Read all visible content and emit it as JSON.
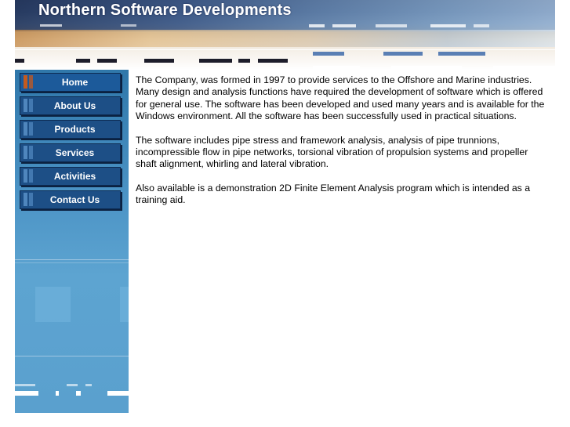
{
  "site": {
    "title": "Northern Software Developments"
  },
  "nav": {
    "items": [
      {
        "label": "Home",
        "active": true
      },
      {
        "label": "About Us",
        "active": false
      },
      {
        "label": "Products",
        "active": false
      },
      {
        "label": "Services",
        "active": false
      },
      {
        "label": "Activities",
        "active": false
      },
      {
        "label": "Contact Us",
        "active": false
      }
    ]
  },
  "content": {
    "paragraphs": [
      "The Company, was formed in 1997 to provide services to the Offshore and Marine industries. Many design and analysis functions have required the development of software which is offered for general use.  The software has been developed and used many years and is available for the Windows environment. All the software has been successfully used in practical situations.",
      "The software includes pipe stress and framework analysis, analysis of pipe trunnions, incompressible flow in pipe networks, torsional vibration of propulsion systems and propeller shaft alignment, whirling and lateral vibration.",
      "Also available is a demonstration 2D Finite Element Analysis program which is intended as a training aid."
    ]
  },
  "colors": {
    "nav_button": "#1d4f86",
    "nav_active_mark": "#c55a1f",
    "sidebar": "#4a92c4",
    "text": "#000000"
  }
}
